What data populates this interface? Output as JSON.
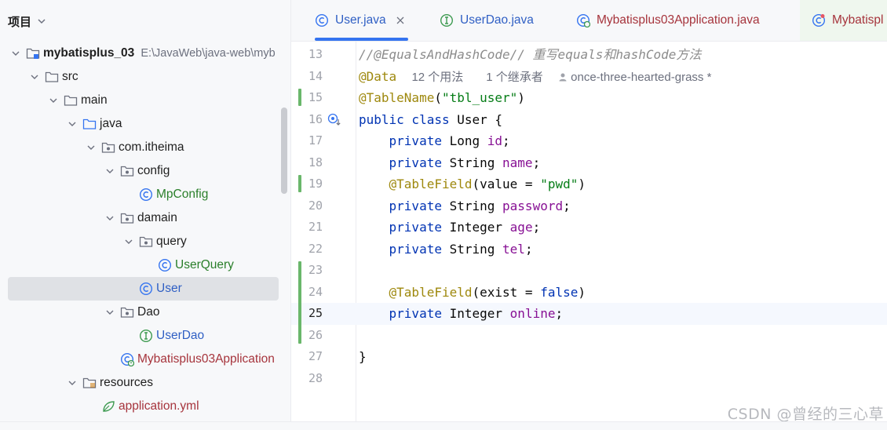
{
  "project_panel": {
    "title": "项目",
    "tree": [
      {
        "label": "mybatisplus_03",
        "path": "E:\\JavaWeb\\java-web\\myb",
        "bold": true
      },
      {
        "label": "src"
      },
      {
        "label": "main"
      },
      {
        "label": "java"
      },
      {
        "label": "com.itheima"
      },
      {
        "label": "config"
      },
      {
        "label": "MpConfig"
      },
      {
        "label": "damain"
      },
      {
        "label": "query"
      },
      {
        "label": "UserQuery"
      },
      {
        "label": "User",
        "selected": true
      },
      {
        "label": "Dao"
      },
      {
        "label": "UserDao"
      },
      {
        "label": "Mybatisplus03Application"
      },
      {
        "label": "resources"
      },
      {
        "label": "application.yml"
      }
    ]
  },
  "tabs": [
    {
      "label": "User.java",
      "active": true,
      "icon": "class-icon"
    },
    {
      "label": "UserDao.java",
      "icon": "interface-icon"
    },
    {
      "label": "Mybatisplus03Application.java",
      "icon": "spring-boot-class-icon"
    },
    {
      "label": "Mybatispl",
      "icon": "run-class-icon"
    }
  ],
  "editor": {
    "current_line": 25,
    "inlay_hint": {
      "usages": "12 个用法",
      "inheritors": "1 个继承者",
      "author": "once-three-hearted-grass *"
    },
    "lines": [
      {
        "n": "13",
        "text": "//@EqualsAndHashCode// 重写equals和hashCode方法"
      },
      {
        "n": "14",
        "text": "@Data"
      },
      {
        "n": "15",
        "text": "@TableName(\"tbl_user\")"
      },
      {
        "n": "16",
        "text": "public class User {"
      },
      {
        "n": "17",
        "text": "    private Long id;"
      },
      {
        "n": "18",
        "text": "    private String name;"
      },
      {
        "n": "19",
        "text": "    @TableField(value = \"pwd\")"
      },
      {
        "n": "20",
        "text": "    private String password;"
      },
      {
        "n": "21",
        "text": "    private Integer age;"
      },
      {
        "n": "22",
        "text": "    private String tel;"
      },
      {
        "n": "23",
        "text": ""
      },
      {
        "n": "24",
        "text": "    @TableField(exist = false)"
      },
      {
        "n": "25",
        "text": "    private Integer online;"
      },
      {
        "n": "26",
        "text": ""
      },
      {
        "n": "27",
        "text": "}"
      },
      {
        "n": "28",
        "text": ""
      }
    ]
  },
  "watermark": "CSDN @曾经的三心草",
  "colors": {
    "accent": "#3574f0",
    "keyword": "#0033b3",
    "annotation": "#9e880d",
    "string": "#067d17",
    "field": "#871094",
    "comment": "#8c8c8c",
    "vcs_added": "#6ab76b"
  }
}
